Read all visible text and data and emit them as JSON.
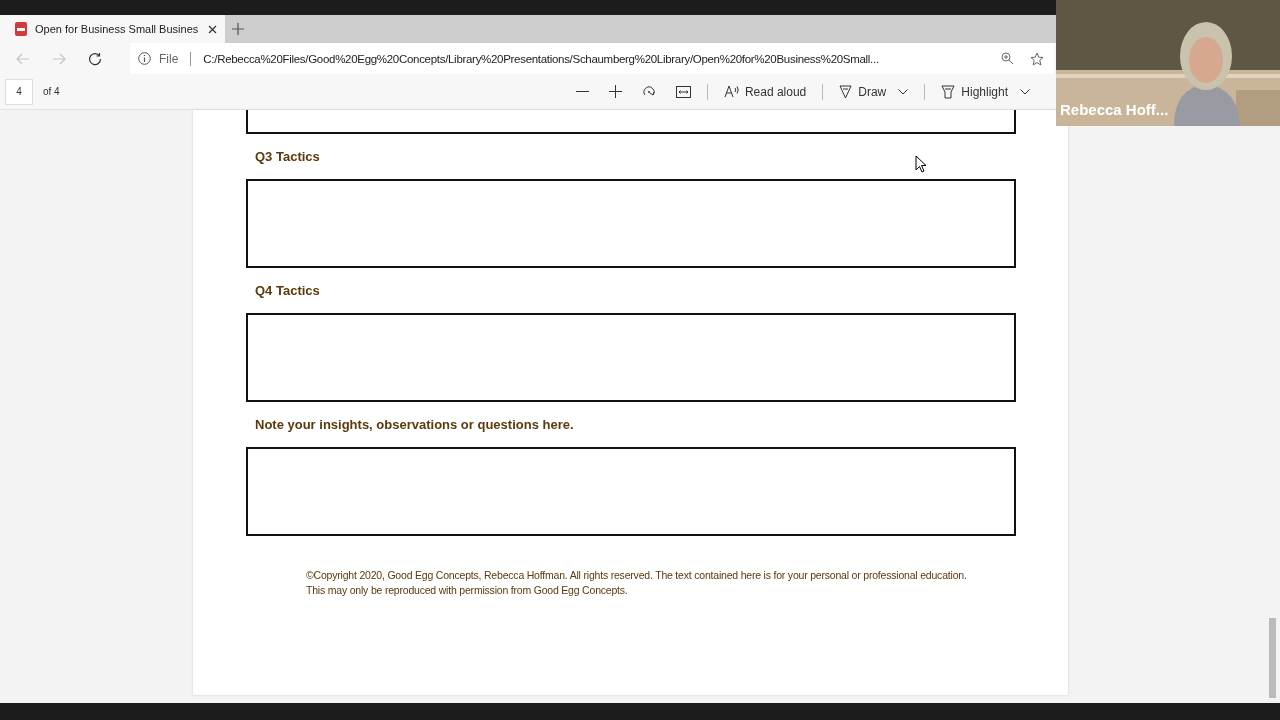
{
  "tabs": [
    {
      "title": "Open for Business Small Busines",
      "selected": true
    }
  ],
  "address_bar": {
    "scheme": "File",
    "url": "C:/Rebecca%20Files/Good%20Egg%20Concepts/Library%20Presentations/Schaumberg%20Library/Open%20for%20Business%20Small..."
  },
  "pdf_toolbar": {
    "page": "4",
    "page_count": "of 4",
    "buttons": [
      {
        "kind": "read",
        "label": "Read aloud"
      },
      {
        "kind": "draw",
        "label": "Draw"
      },
      {
        "kind": "highlight",
        "label": "Highlight"
      }
    ]
  },
  "document": {
    "sections": [
      {
        "heading": "Q3 Tactics"
      },
      {
        "heading": "Q4 Tactics"
      },
      {
        "heading": "Note your insights, observations or questions here."
      }
    ],
    "copyright_lines": [
      "©Copyright 2020, Good Egg Concepts, Rebecca Hoffman.  All rights reserved.  The text contained here is for your personal or professional education.",
      "This may only be reproduced with permission from Good Egg Concepts."
    ]
  },
  "video": {
    "kind": "picture",
    "name": "Rebecca Hoff..."
  }
}
